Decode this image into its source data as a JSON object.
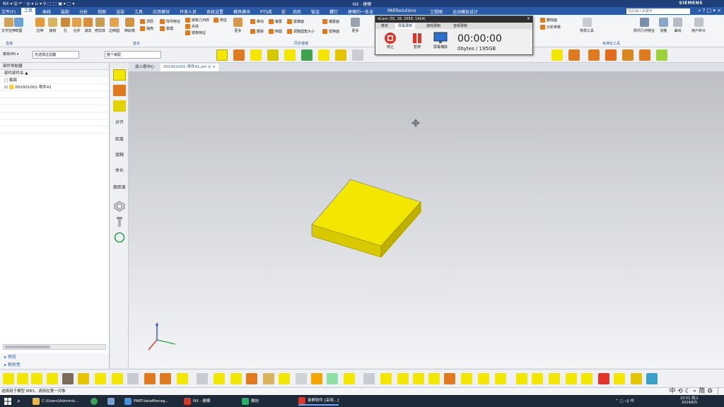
{
  "window": {
    "title": "NX - 建模",
    "brand": "SIEMENS",
    "quick_access": "NX ▾ 🖫 ↶ · ◎ ▾ ⎌ ▾ ⚲ ⬚ ⬚ ▣ ▾ ⬚ ▾"
  },
  "menu": {
    "items": [
      "文件(F)",
      "工具",
      "曲线",
      "装配",
      "分析",
      "视图",
      "渲染",
      "工具",
      "应用模块",
      "开发人员",
      "系统设置",
      "模具模块",
      "PTS库",
      "宏",
      "齿轮",
      "钣金",
      "螺钉",
      "建模的一条龙",
      "PARTsolutions",
      "工程图",
      "运动模拟设计"
    ],
    "active_index": 1,
    "search_placeholder": "在此输入关键字",
    "win_controls": "⌕ ? □ ▾ ×"
  },
  "ribbon": {
    "large_items": [
      "文字拉伸",
      "草图",
      "拉伸",
      "旋转",
      "孔",
      "合并",
      "减去",
      "修剪体",
      "边倒圆",
      "倒斜角",
      "更多"
    ],
    "small_items": [
      "顶层",
      "阵列特征",
      "镜像几何体",
      "实体",
      "抽壳",
      "合并",
      "倒圆",
      "特征",
      "拔模",
      "镜像特征",
      "移动",
      "偏置",
      "拔模面",
      "删除",
      "倒圆",
      "偏置区域",
      "替换面",
      "调整圆角大小",
      "偏置面",
      "隐藏",
      "显示",
      "更多"
    ],
    "right_items": [
      "特征组",
      "阵列几何特征",
      "测量",
      "曲线",
      "图层类型",
      "拉伸到",
      "常规工具",
      "用户命令",
      "删除面",
      "分析参数"
    ],
    "group_labels": [
      "直接",
      "基本",
      "同步建模",
      "标准化工具"
    ]
  },
  "toolbar2": {
    "menu_label": "菜单(M) ▾",
    "filter_value": "无选择过滤器",
    "assembly_value": "整个装配"
  },
  "recorder": {
    "title": "oCam (35, 16, 2559, 1414)",
    "tabs": [
      "菜单",
      "屏幕录制",
      "游戏录制",
      "音频录制"
    ],
    "active_tab": 1,
    "buttons": [
      "停止",
      "暂停",
      "屏幕捕获"
    ],
    "time": "00:00:00",
    "size": "0bytes / 195GB",
    "close": "×"
  },
  "tabs": {
    "items": [
      "加入视中心",
      "001001001-零件41.prt ◎ ×"
    ],
    "active_index": 1
  },
  "navigator": {
    "title": "部件导航器",
    "column_header": "部件部件名 ▲",
    "rows": [
      "□ 截面",
      "☑ 🟨 001001001-零件41"
    ]
  },
  "bottom_panel": {
    "items": [
      "▸ 预览",
      "▸ 相关性"
    ]
  },
  "side_strip": {
    "labels": [
      "对齐",
      "距离",
      "接触",
      "体长",
      "面距离"
    ]
  },
  "status": {
    "text": "选择用于模型 MB3，请用在第一对象",
    "ime": "中 ⟲ ☾ ∘ 简 ⚙ ⋮"
  },
  "taskbar": {
    "items": [
      "C:\\Users\\Adminis...",
      "PARTdataManag...",
      "NX - 建模",
      "微信",
      "录屏软件 [采用...]"
    ],
    "active_index": 4,
    "tray": "⌃ ▢ ◁) 中",
    "time": "15:51 周三",
    "date": "2024/6/5"
  },
  "colors": {
    "accent": "#2b5aa8",
    "title": "#1f3f7a",
    "part_yellow": "#f3e600",
    "recorder_red": "#e0342a"
  }
}
